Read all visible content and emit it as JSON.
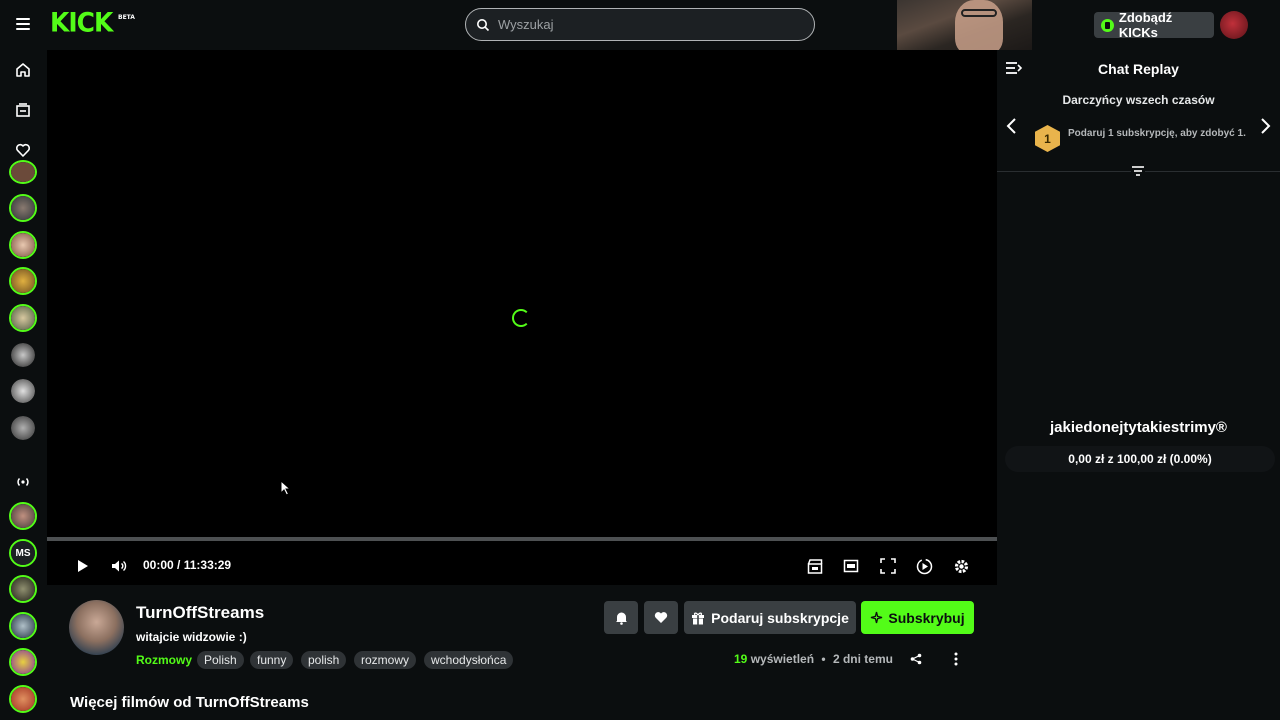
{
  "header": {
    "logo_text": "KICK",
    "logo_badge": "BETA",
    "search_placeholder": "Wyszukaj",
    "kicks_label": "Zdobądź KICKs"
  },
  "player": {
    "time_current": "00:00",
    "time_separator": "/",
    "time_total": "11:33:29"
  },
  "chat": {
    "title": "Chat Replay",
    "gifters_title": "Darczyńcy wszech czasów",
    "gift_rank": "1",
    "gift_text": "Podaruj 1 subskrypcję, aby zdobyć 1.",
    "goal_name": "jakiedonejtytakiestrimy®",
    "goal_progress": "0,00 zł z 100,00 zł (0.00%)"
  },
  "channel": {
    "name": "TurnOffStreams",
    "stream_title": "witajcie widzowie :)",
    "category": "Rozmowy",
    "tags": [
      "Polish",
      "funny",
      "polish",
      "rozmowy",
      "wchodysłońca"
    ],
    "gift_button": "Podaruj subskrypcje",
    "subscribe_button": "Subskrybuj",
    "views_count": "19",
    "views_label": "wyświetleń",
    "meta_separator": "•",
    "posted_ago": "2 dni temu",
    "more_videos_heading": "Więcej filmów od TurnOffStreams"
  },
  "sidebar": {
    "channel_initials": "MS"
  },
  "colors": {
    "accent": "#53fc18",
    "background": "#0b0e0f",
    "button_dark": "#3a3f42"
  }
}
